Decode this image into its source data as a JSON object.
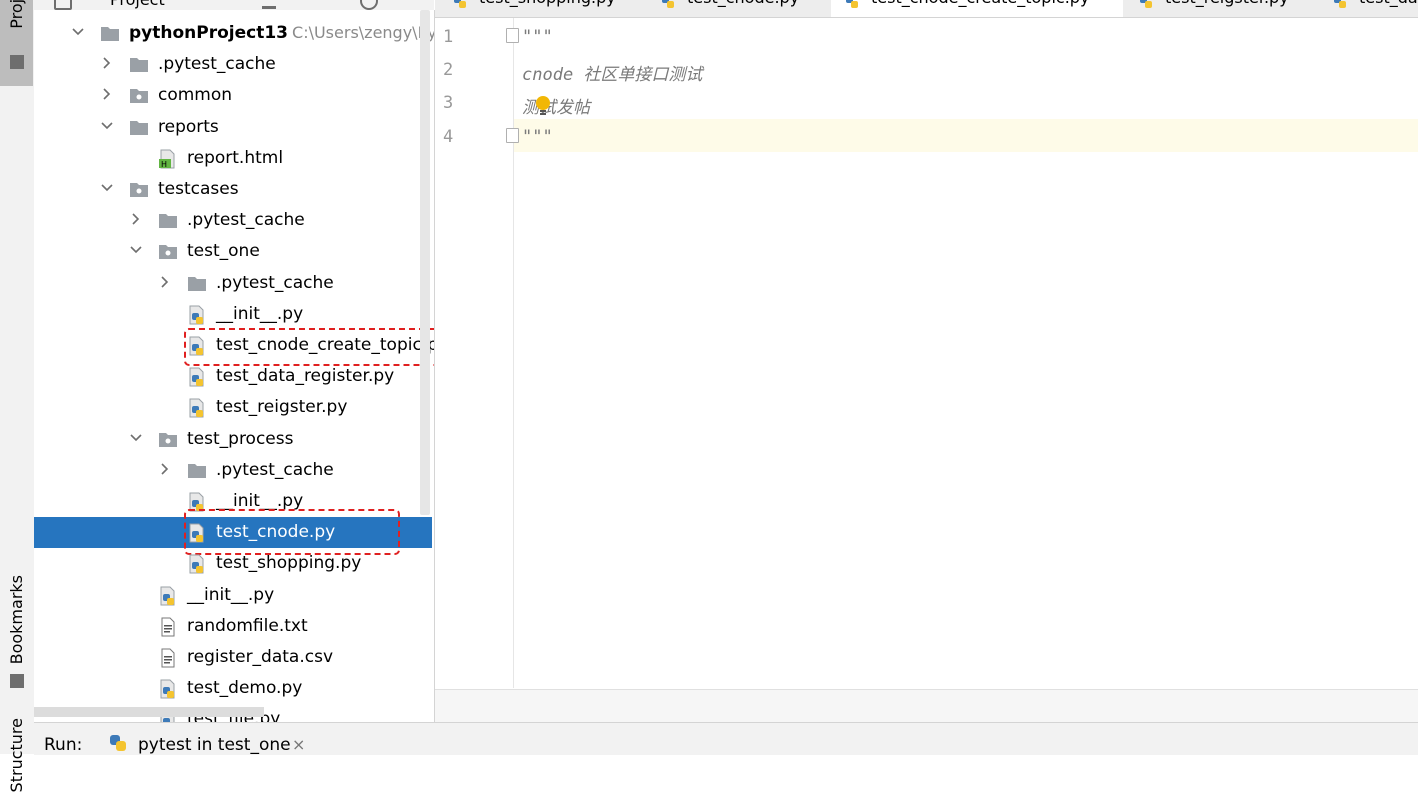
{
  "tool_strip": {
    "project_label": "Project",
    "bookmarks_label": "Bookmarks",
    "structure_label": "Structure"
  },
  "project_panel": {
    "title": "Project"
  },
  "tree": [
    {
      "name": "pythonProject13",
      "path": "C:\\Users\\zengy\\PycharmProjects",
      "indent": 0,
      "arrow": "down",
      "icon": "folder",
      "bold": true
    },
    {
      "name": ".pytest_cache",
      "indent": 1,
      "arrow": "right",
      "icon": "folder"
    },
    {
      "name": "common",
      "indent": 1,
      "arrow": "right",
      "icon": "package-folder"
    },
    {
      "name": "reports",
      "indent": 1,
      "arrow": "down",
      "icon": "folder"
    },
    {
      "name": "report.html",
      "indent": 2,
      "arrow": "none",
      "icon": "html-file"
    },
    {
      "name": "testcases",
      "indent": 1,
      "arrow": "down",
      "icon": "package-folder"
    },
    {
      "name": ".pytest_cache",
      "indent": 2,
      "arrow": "right",
      "icon": "folder"
    },
    {
      "name": "test_one",
      "indent": 2,
      "arrow": "down",
      "icon": "package-folder"
    },
    {
      "name": ".pytest_cache",
      "indent": 3,
      "arrow": "right",
      "icon": "folder"
    },
    {
      "name": "__init__.py",
      "indent": 3,
      "arrow": "none",
      "icon": "python-file"
    },
    {
      "name": "test_cnode_create_topic.py",
      "indent": 3,
      "arrow": "none",
      "icon": "python-file",
      "highlight": true
    },
    {
      "name": "test_data_register.py",
      "indent": 3,
      "arrow": "none",
      "icon": "python-file"
    },
    {
      "name": "test_reigster.py",
      "indent": 3,
      "arrow": "none",
      "icon": "python-file"
    },
    {
      "name": "test_process",
      "indent": 2,
      "arrow": "down",
      "icon": "package-folder"
    },
    {
      "name": ".pytest_cache",
      "indent": 3,
      "arrow": "right",
      "icon": "folder"
    },
    {
      "name": "__init__.py",
      "indent": 3,
      "arrow": "none",
      "icon": "python-file"
    },
    {
      "name": "test_cnode.py",
      "indent": 3,
      "arrow": "none",
      "icon": "python-file",
      "selected": true,
      "highlight": true
    },
    {
      "name": "test_shopping.py",
      "indent": 3,
      "arrow": "none",
      "icon": "python-file"
    },
    {
      "name": "__init__.py",
      "indent": 2,
      "arrow": "none",
      "icon": "python-file"
    },
    {
      "name": "randomfile.txt",
      "indent": 2,
      "arrow": "none",
      "icon": "text-file"
    },
    {
      "name": "register_data.csv",
      "indent": 2,
      "arrow": "none",
      "icon": "text-file"
    },
    {
      "name": "test_demo.py",
      "indent": 2,
      "arrow": "none",
      "icon": "python-file"
    },
    {
      "name": "test_file.py",
      "indent": 2,
      "arrow": "none",
      "icon": "python-file"
    }
  ],
  "editor": {
    "tabs": [
      {
        "label": "test_shopping.py",
        "active": false
      },
      {
        "label": "test_cnode.py",
        "active": false
      },
      {
        "label": "test_cnode_create_topic.py",
        "active": true,
        "closable": true
      },
      {
        "label": "test_reigster.py",
        "active": false
      },
      {
        "label": "test_data_register.py",
        "active": false
      }
    ],
    "lines": [
      {
        "num": "1",
        "text": "\"\"\""
      },
      {
        "num": "2",
        "text": "cnode 社区单接口测试"
      },
      {
        "num": "3",
        "text": "测试发帖"
      },
      {
        "num": "4",
        "text": "\"\"\""
      }
    ],
    "current_line": 4,
    "close_glyph": "×"
  },
  "run_bar": {
    "label": "Run:",
    "tab_label": "pytest in test_one",
    "close_glyph": "×"
  },
  "colors": {
    "selection": "#2675bf",
    "highlight_border": "#e02020",
    "current_line": "#fefbe8",
    "active_tab_underline": "#4a88c7"
  }
}
